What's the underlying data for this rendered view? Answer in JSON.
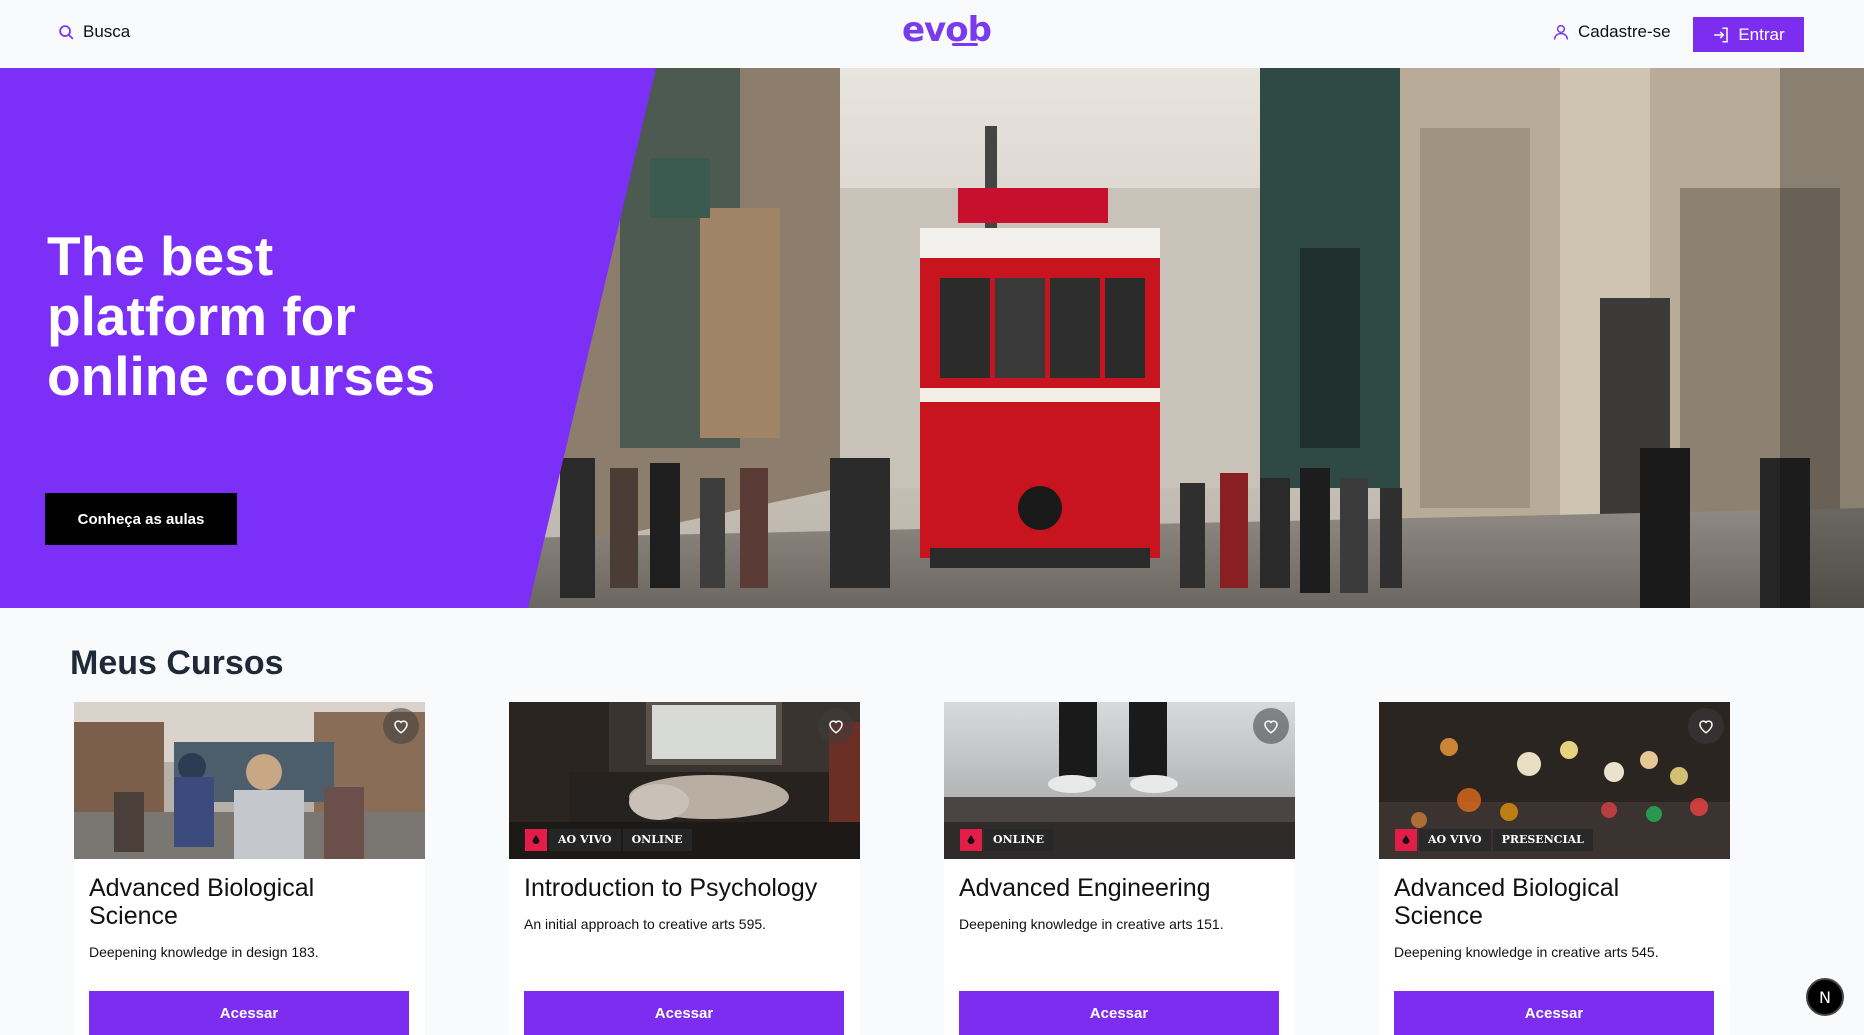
{
  "header": {
    "search_label": "Busca",
    "logo": "evob",
    "register_label": "Cadastre-se",
    "login_label": "Entrar"
  },
  "hero": {
    "title": "The best platform for online courses",
    "cta_label": "Conheça as aulas"
  },
  "section": {
    "title": "Meus Cursos"
  },
  "courses": [
    {
      "title": "Advanced Biological Science",
      "description": "Deepening knowledge in design 183.",
      "badges": [],
      "button_label": "Acessar"
    },
    {
      "title": "Introduction to Psychology",
      "description": "An initial approach to creative arts 595.",
      "badges": [
        "AO VIVO",
        "ONLINE"
      ],
      "button_label": "Acessar"
    },
    {
      "title": "Advanced Engineering",
      "description": "Deepening knowledge in creative arts 151.",
      "badges": [
        "ONLINE"
      ],
      "button_label": "Acessar"
    },
    {
      "title": "Advanced Biological Science",
      "description": "Deepening knowledge in creative arts 545.",
      "badges": [
        "AO VIVO",
        "PRESENCIAL"
      ],
      "button_label": "Acessar"
    }
  ],
  "dev_indicator": "N",
  "colors": {
    "accent": "#7c2df0",
    "hero_purple": "#7b2ff7",
    "badge_red": "#e11d48",
    "page_bg": "#f8fafc"
  }
}
